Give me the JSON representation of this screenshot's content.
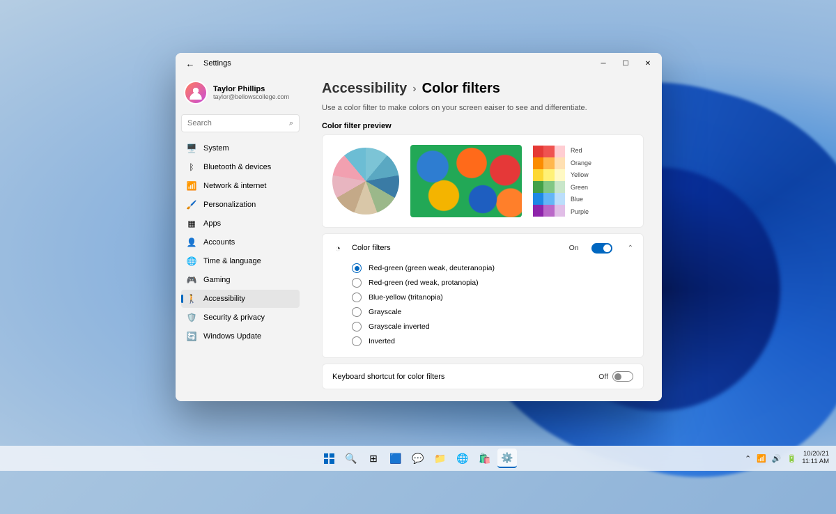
{
  "titlebar": {
    "label": "Settings"
  },
  "user": {
    "name": "Taylor Phillips",
    "email": "taylor@bellowscollege.com"
  },
  "search": {
    "placeholder": "Search"
  },
  "nav": [
    {
      "ico": "🖥️",
      "label": "System"
    },
    {
      "ico": "ᛒ",
      "label": "Bluetooth & devices"
    },
    {
      "ico": "📶",
      "label": "Network & internet"
    },
    {
      "ico": "🖌️",
      "label": "Personalization"
    },
    {
      "ico": "▦",
      "label": "Apps"
    },
    {
      "ico": "👤",
      "label": "Accounts"
    },
    {
      "ico": "🌐",
      "label": "Time & language"
    },
    {
      "ico": "🎮",
      "label": "Gaming"
    },
    {
      "ico": "🚶",
      "label": "Accessibility",
      "active": true
    },
    {
      "ico": "🛡️",
      "label": "Security & privacy"
    },
    {
      "ico": "🔄",
      "label": "Windows Update"
    }
  ],
  "breadcrumb": {
    "parent": "Accessibility",
    "sep": "›",
    "current": "Color filters"
  },
  "description": "Use a color filter to make colors on your screen eaiser to see and differentiate.",
  "preview_label": "Color filter preview",
  "swatch_names": [
    "Red",
    "Orange",
    "Yellow",
    "Green",
    "Blue",
    "Purple"
  ],
  "filter_toggle": {
    "title": "Color filters",
    "state_label": "On",
    "on": true
  },
  "filters": [
    {
      "label": "Red-green (green weak, deuteranopia)",
      "checked": true
    },
    {
      "label": "Red-green (red weak, protanopia)"
    },
    {
      "label": "Blue-yellow (tritanopia)"
    },
    {
      "label": "Grayscale"
    },
    {
      "label": "Grayscale inverted"
    },
    {
      "label": "Inverted"
    }
  ],
  "shortcut": {
    "title": "Keyboard shortcut for color filters",
    "state_label": "Off",
    "on": false
  },
  "systray": {
    "date": "10/20/21",
    "time": "11:11 AM"
  }
}
